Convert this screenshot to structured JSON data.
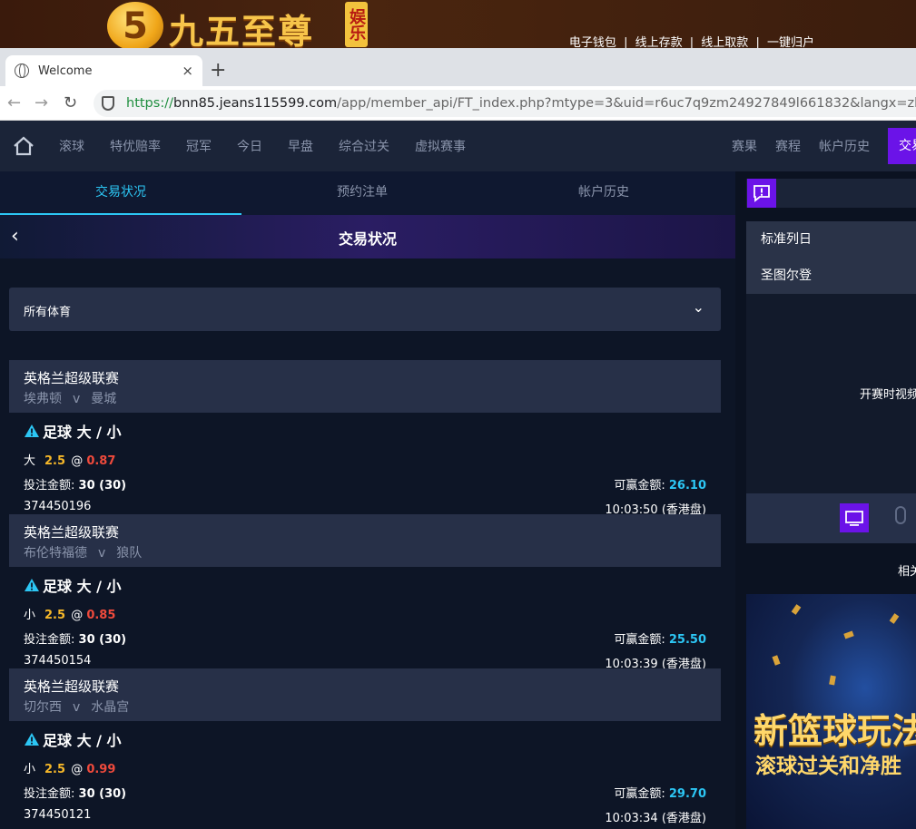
{
  "banner": {
    "logo_number": "5",
    "logo_name": "九五至尊",
    "logo_tag": "娱乐城",
    "links": [
      "电子钱包",
      "线上存款",
      "线上取款",
      "一键归户"
    ],
    "separator": "|"
  },
  "browser": {
    "tab_title": "Welcome",
    "tab_close": "×",
    "new_tab": "+",
    "url_scheme": "https://",
    "url_host": "bnn85.jeans115599.com",
    "url_path": "/app/member_api/FT_index.php?mtype=3&uid=r6uc7q9zm24927849l661832&langx=zh-cn&news_"
  },
  "nav": {
    "items": [
      "滚球",
      "特优赔率",
      "冠军",
      "今日",
      "早盘",
      "综合过关",
      "虚拟赛事"
    ],
    "right_items": [
      "赛果",
      "赛程",
      "帐户历史"
    ],
    "active_item": "交易状况"
  },
  "subtabs": [
    "交易状况",
    "预约注单",
    "帐户历史"
  ],
  "hero_title": "交易状况",
  "sport_filter": "所有体育",
  "labels": {
    "stake": "投注金额:",
    "to_win": "可赢金额:",
    "at": "@",
    "vs": "v",
    "odds_type": "(香港盘)"
  },
  "bets": [
    {
      "league": "英格兰超级联赛",
      "home": "埃弗顿",
      "away": "曼城",
      "market": "足球 大 / 小",
      "selection": "大",
      "handicap": "2.5",
      "odds": "0.87",
      "stake": "30 (30)",
      "to_win": "26.10",
      "ticket": "374450196",
      "time": "10:03:50"
    },
    {
      "league": "英格兰超级联赛",
      "home": "布伦特福德",
      "away": "狼队",
      "market": "足球 大 / 小",
      "selection": "小",
      "handicap": "2.5",
      "odds": "0.85",
      "stake": "30 (30)",
      "to_win": "25.50",
      "ticket": "374450154",
      "time": "10:03:39"
    },
    {
      "league": "英格兰超级联赛",
      "home": "切尔西",
      "away": "水晶宫",
      "market": "足球 大 / 小",
      "selection": "小",
      "handicap": "2.5",
      "odds": "0.99",
      "stake": "30 (30)",
      "to_win": "29.70",
      "ticket": "374450121",
      "time": "10:03:34"
    }
  ],
  "right_panel": {
    "list": [
      "标准列日",
      "圣图尔登"
    ],
    "video_text": "开赛时视频",
    "related": "相关",
    "promo_line1": "新篮球玩法",
    "promo_line2": "滚球过关和净胜"
  },
  "colors": {
    "accent_purple": "#6b13e8",
    "accent_cyan": "#2cc6f4",
    "handicap_orange": "#f5b729",
    "odds_red": "#ef4a3c"
  }
}
